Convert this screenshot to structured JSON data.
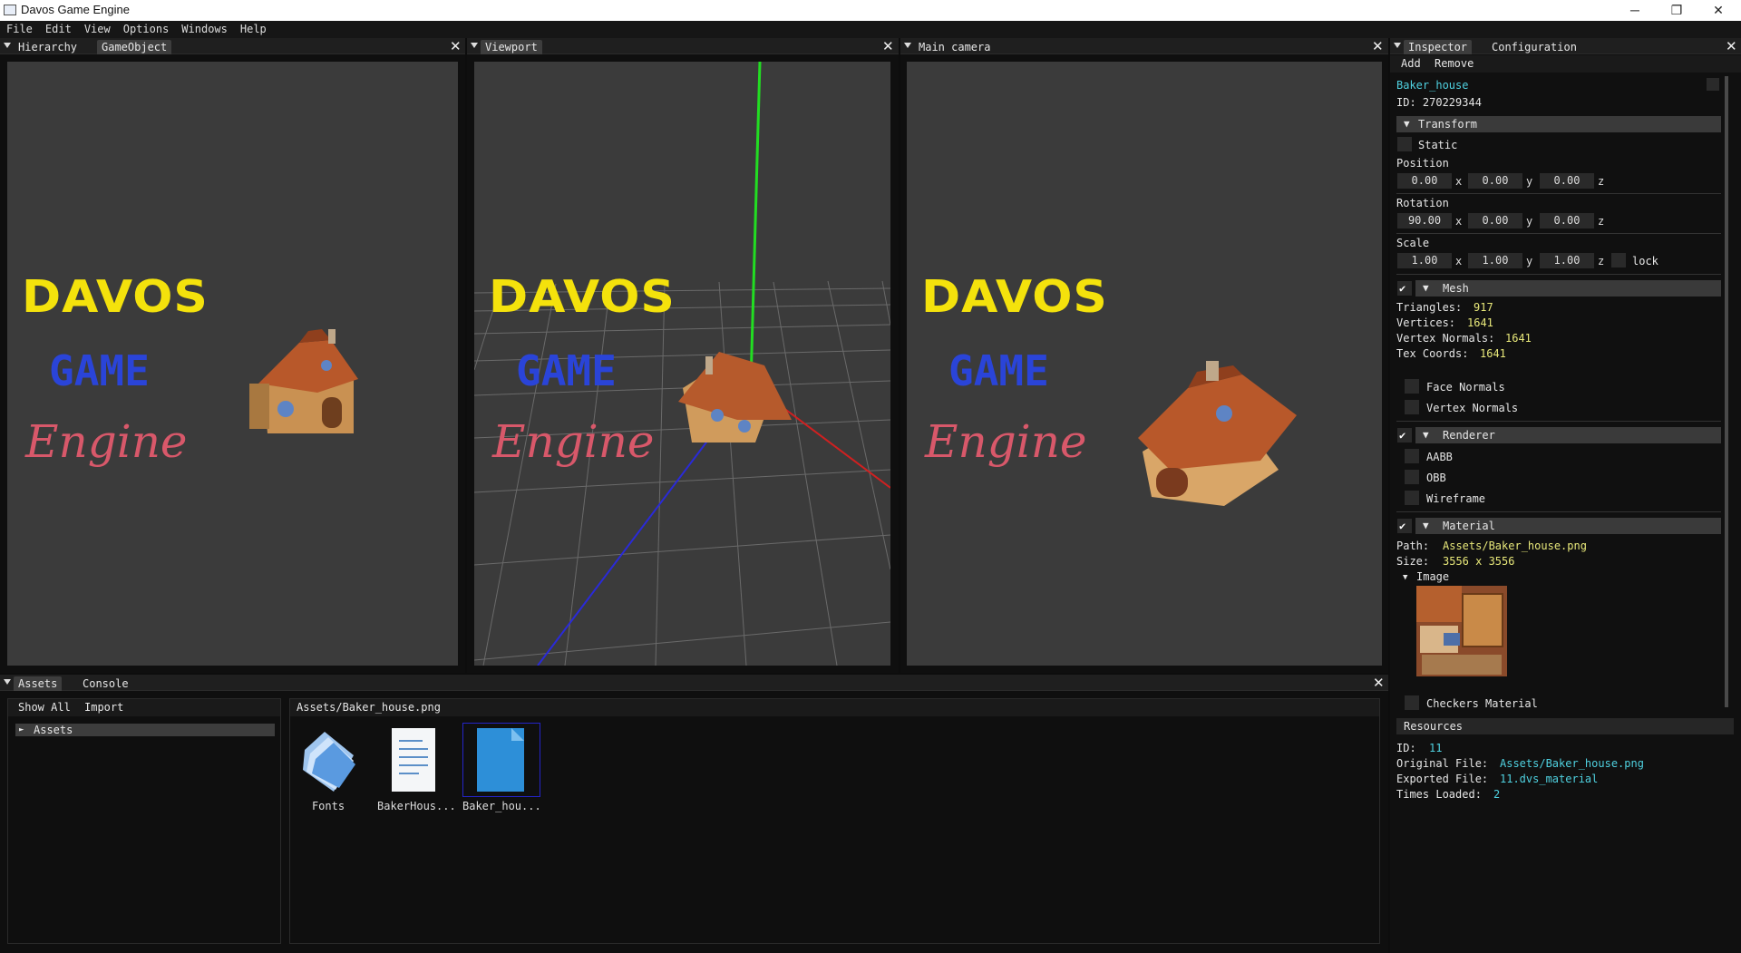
{
  "window": {
    "title": "Davos Game Engine",
    "minimize": "─",
    "maximize": "❐",
    "close": "✕"
  },
  "menu": [
    "File",
    "Edit",
    "View",
    "Options",
    "Windows",
    "Help"
  ],
  "left_panel": {
    "tabs": [
      "Hierarchy",
      "GameObject"
    ]
  },
  "viewport_panel": {
    "tabs": [
      "Viewport"
    ]
  },
  "camera_panel": {
    "tabs": [
      "Main camera"
    ]
  },
  "logo": {
    "line1": "DAVOS",
    "line2": "GAME",
    "line3": "Engine"
  },
  "inspector": {
    "tabs": [
      "Inspector",
      "Configuration"
    ],
    "toolbar": {
      "add": "Add",
      "remove": "Remove"
    },
    "object_name": "Baker_house",
    "id_text": "ID: 270229344",
    "transform": {
      "header": "Transform",
      "static_label": "Static",
      "position_label": "Position",
      "position": [
        "0.00",
        "0.00",
        "0.00"
      ],
      "rotation_label": "Rotation",
      "rotation": [
        "90.00",
        "0.00",
        "0.00"
      ],
      "scale_label": "Scale",
      "scale": [
        "1.00",
        "1.00",
        "1.00"
      ],
      "axes": [
        "x",
        "y",
        "z"
      ],
      "lock_label": "lock"
    },
    "mesh": {
      "header": "Mesh",
      "triangles_label": "Triangles:",
      "triangles": "917",
      "vertices_label": "Vertices:",
      "vertices": "1641",
      "normals_label": "Vertex Normals:",
      "normals": "1641",
      "texcoords_label": "Tex Coords:",
      "texcoords": "1641",
      "face_normals": "Face Normals",
      "vertex_normals": "Vertex Normals"
    },
    "renderer": {
      "header": "Renderer",
      "aabb": "AABB",
      "obb": "OBB",
      "wireframe": "Wireframe"
    },
    "material": {
      "header": "Material",
      "path_label": "Path:",
      "path": "Assets/Baker_house.png",
      "size_label": "Size:",
      "size": "3556 x 3556",
      "image_label": "Image",
      "checkers": "Checkers Material"
    },
    "resources": {
      "header": "Resources",
      "id_label": "ID:",
      "id": "11",
      "original_label": "Original File:",
      "original": "Assets/Baker_house.png",
      "exported_label": "Exported File:",
      "exported": "11.dvs_material",
      "times_label": "Times Loaded:",
      "times": "2"
    }
  },
  "bottom": {
    "tabs": [
      "Assets",
      "Console"
    ],
    "toolbar": {
      "show_all": "Show All",
      "import": "Import"
    },
    "tree_item": "Assets",
    "path": "Assets/Baker_house.png",
    "files": [
      "Fonts",
      "BakerHous...",
      "Baker_hou..."
    ]
  },
  "colors": {
    "accent_yellow": "#e8e87a",
    "accent_cyan": "#4fd1e0",
    "logo_yellow": "#f4e20c",
    "logo_blue": "#2a44d8",
    "logo_pink": "#d8586a"
  }
}
